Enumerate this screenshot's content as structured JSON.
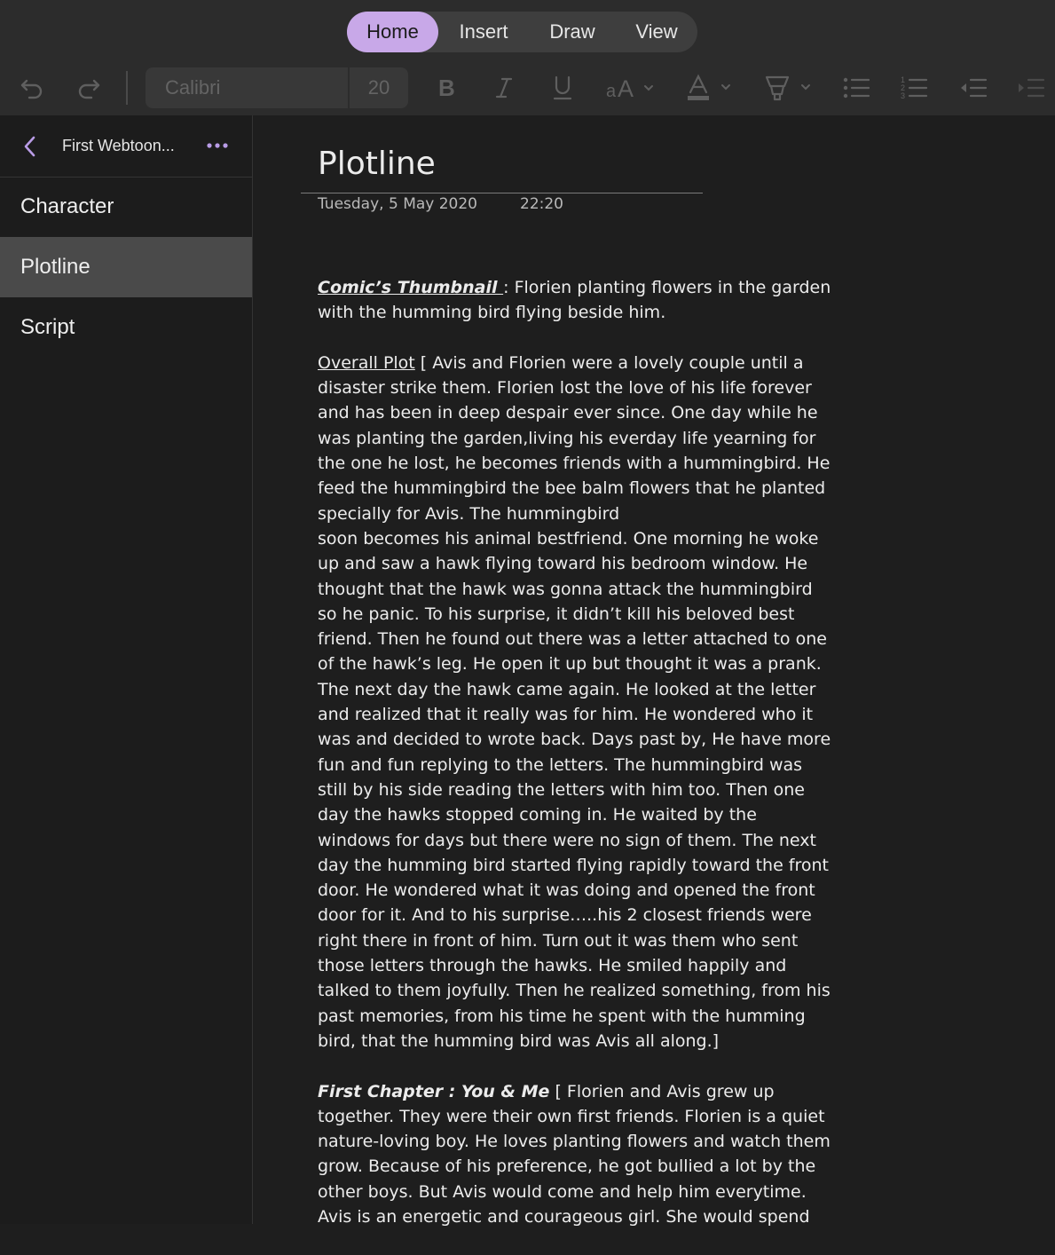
{
  "ribbon": {
    "tabs": [
      "Home",
      "Insert",
      "Draw",
      "View"
    ],
    "active_tab": "Home",
    "font_name": "Calibri",
    "font_size": "20",
    "icons": [
      "undo-icon",
      "redo-icon",
      "bold-icon",
      "italic-icon",
      "underline-icon",
      "font-size-icon",
      "font-color-icon",
      "highlighter-icon",
      "bullet-list-icon",
      "numbered-list-icon",
      "outdent-icon",
      "indent-icon"
    ]
  },
  "sidebar": {
    "notebook_title": "First Webtoon...",
    "pages": [
      {
        "label": "Character",
        "selected": false
      },
      {
        "label": "Plotline",
        "selected": true
      },
      {
        "label": "Script",
        "selected": false
      }
    ]
  },
  "page": {
    "title": "Plotline",
    "date": "Tuesday, 5 May 2020",
    "time": "22:20",
    "para1": {
      "heading": "Comic’s Thumbnail ",
      "text": ": Florien planting flowers in the garden with the humming bird flying beside him."
    },
    "para2": {
      "heading": "Overall Plot",
      "text": " [ Avis and Florien were a lovely couple until a disaster strike them. Florien lost the love of his life forever and has been in deep despair ever since. One day while he was planting the garden,living his everday life yearning for the one he lost, he becomes friends with a hummingbird. He feed the hummingbird the bee balm flowers that he planted specially for Avis. The hummingbird",
      "text2": " soon becomes his animal bestfriend. One morning he woke up and saw a hawk flying toward his bedroom window. He thought that the hawk was gonna attack the hummingbird so he panic. To his surprise, it didn’t kill his beloved best friend. Then he found out there was a letter attached to one of the hawk’s leg. He open it up but thought it was a prank. The next day the hawk came again. He looked at the letter and realized that it really was for him. He wondered who it was and decided to wrote back. Days past by, He have more fun and fun replying to the letters. The hummingbird was still by his side reading the letters with him too. Then one day the hawks stopped coming in. He waited by the windows for days but there were no sign of them. The next day the humming bird started flying rapidly toward the front door. He wondered what it was doing and opened the front door for it. And to his surprise…..his 2 closest friends were right there in front of him. Turn out it was them who sent those letters through the hawks. He smiled happily and talked to them joyfully. Then he realized something, from his past memories, from his time he spent with the humming bird, that the humming bird was Avis all along.]"
    },
    "para3": {
      "heading": "First Chapter : You & Me",
      "text": " [ Florien and Avis grew up together. They were their own first friends. Florien is a quiet nature-loving boy. He loves planting flowers and watch them grow. Because of his preference, he got bullied a lot by the other boys. But Avis would come and help him everytime. Avis is an energetic and courageous girl. She would spend"
    }
  }
}
